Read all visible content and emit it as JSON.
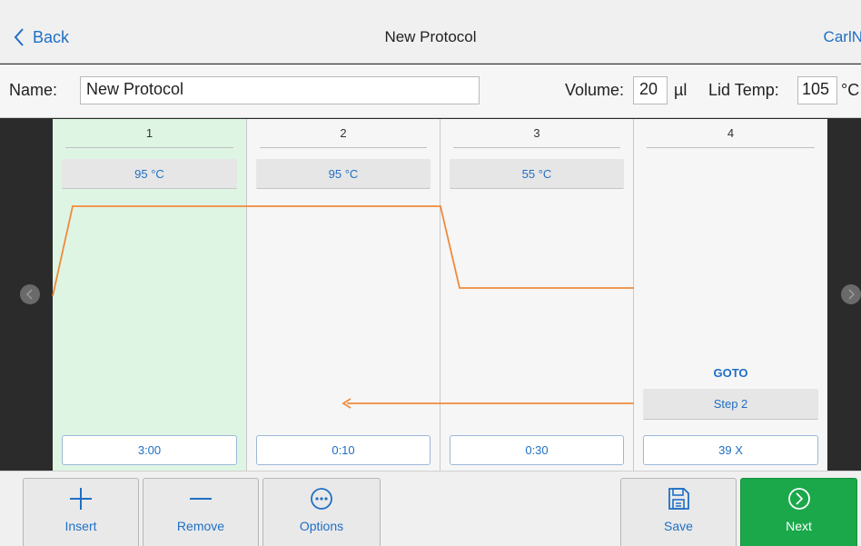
{
  "header": {
    "back_label": "Back",
    "title": "New Protocol",
    "user": "CarlN"
  },
  "form": {
    "name_label": "Name:",
    "name_value": "New Protocol",
    "volume_label": "Volume:",
    "volume_value": "20",
    "volume_unit": "µl",
    "lid_label": "Lid Temp:",
    "lid_value": "105",
    "lid_unit": "°C"
  },
  "steps": [
    {
      "number": "1",
      "temp": "95 °C",
      "time": "3:00",
      "selected": true
    },
    {
      "number": "2",
      "temp": "95 °C",
      "time": "0:10"
    },
    {
      "number": "3",
      "temp": "55 °C",
      "time": "0:30"
    },
    {
      "number": "4",
      "goto_label": "GOTO",
      "goto_target": "Step 2",
      "cycles": "39 X"
    }
  ],
  "toolbar": {
    "insert": "Insert",
    "remove": "Remove",
    "options": "Options",
    "save": "Save",
    "next": "Next"
  },
  "colors": {
    "accent": "#1f6fc5",
    "curve": "#f08a3c",
    "selected_step": "#dff5e4",
    "next_button": "#1aa84a"
  },
  "icons": {
    "back": "chevron-left-icon",
    "insert": "plus-icon",
    "remove": "minus-icon",
    "options": "more-icon",
    "save": "floppy-disk-icon",
    "next": "circle-chevron-right-icon"
  }
}
